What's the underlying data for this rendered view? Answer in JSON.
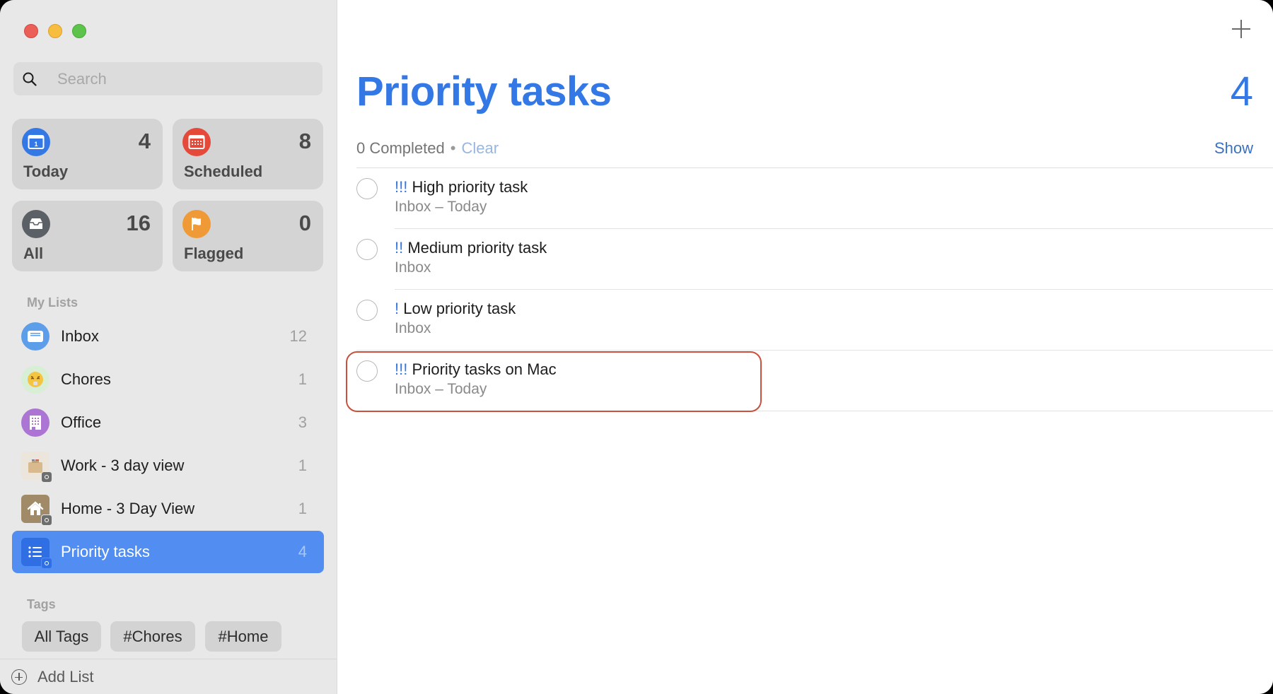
{
  "window": {
    "controls": [
      "close",
      "minimize",
      "maximize"
    ]
  },
  "sidebar": {
    "search": {
      "placeholder": "Search",
      "value": ""
    },
    "smart_lists": [
      {
        "name": "Today",
        "count": "4",
        "icon": "calendar-today-icon",
        "color": "#3478e6"
      },
      {
        "name": "Scheduled",
        "count": "8",
        "icon": "calendar-scheduled-icon",
        "color": "#e5493a"
      },
      {
        "name": "All",
        "count": "16",
        "icon": "tray-icon",
        "color": "#5b5f66"
      },
      {
        "name": "Flagged",
        "count": "0",
        "icon": "flag-icon",
        "color": "#f09a37"
      }
    ],
    "my_lists_label": "My Lists",
    "lists": [
      {
        "name": "Inbox",
        "count": "12",
        "icon": "inbox-icon",
        "color": "#5d9eea"
      },
      {
        "name": "Chores",
        "count": "1",
        "icon": "emoji-steam-face-icon",
        "color": "#d8efd6"
      },
      {
        "name": "Office",
        "count": "3",
        "icon": "building-icon",
        "color": "#ac74d3"
      },
      {
        "name": "Work - 3 day view",
        "count": "1",
        "icon": "box-icon",
        "color": "#ece5dc"
      },
      {
        "name": "Home - 3 Day View",
        "count": "1",
        "icon": "house-icon",
        "color": "#a08a67"
      },
      {
        "name": "Priority tasks",
        "count": "4",
        "icon": "list-bullets-icon",
        "color": "#2f6fe3",
        "selected": true
      }
    ],
    "tags_label": "Tags",
    "tags": [
      "All Tags",
      "#Chores",
      "#Home"
    ],
    "add_list_label": "Add List"
  },
  "main": {
    "title": "Priority tasks",
    "count": "4",
    "completed_text": "0 Completed",
    "separator": "•",
    "clear_label": "Clear",
    "show_label": "Show",
    "accent_color": "#3478e6",
    "tasks": [
      {
        "priority": "!!!",
        "title": "High priority task",
        "subtitle": "Inbox – Today"
      },
      {
        "priority": "!!",
        "title": "Medium priority task",
        "subtitle": "Inbox"
      },
      {
        "priority": "!",
        "title": "Low priority task",
        "subtitle": "Inbox"
      },
      {
        "priority": "!!!",
        "title": "Priority tasks on Mac",
        "subtitle": "Inbox – Today",
        "highlighted": true
      }
    ],
    "highlight_color": "#c9503a"
  }
}
